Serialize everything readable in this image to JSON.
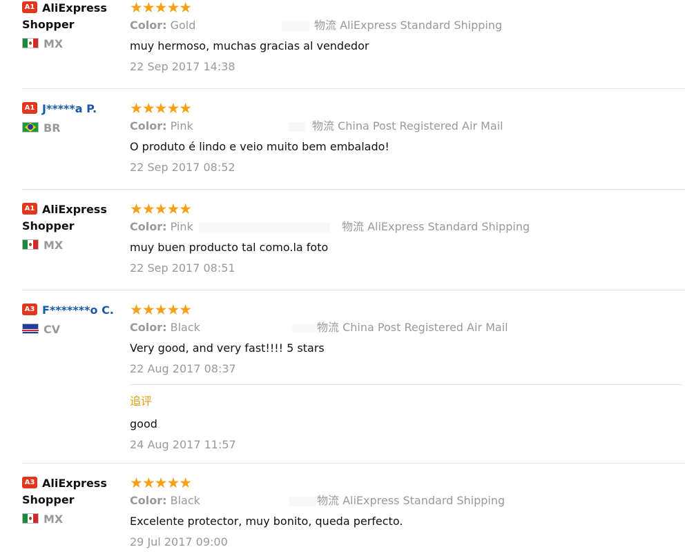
{
  "labels": {
    "color": "Color:"
  },
  "reviews": [
    {
      "badge": "A1",
      "name_line1": "AliExpress",
      "name_line2": "Shopper",
      "country": "MX",
      "stars": "★★★★★",
      "color_value": "Gold",
      "shipping": "物流 AliExpress Standard Shipping",
      "comment": "muy hermoso, muchas gracias al vendedor",
      "date": "22 Sep 2017 14:38"
    },
    {
      "badge": "A1",
      "name_line1": "J*****a P.",
      "name_line2": "",
      "country": "BR",
      "stars": "★★★★★",
      "color_value": "Pink",
      "shipping": "物流 China Post Registered Air Mail",
      "comment": "O produto é lindo e veio muito bem embalado!",
      "date": "22 Sep 2017 08:52"
    },
    {
      "badge": "A1",
      "name_line1": "AliExpress",
      "name_line2": "Shopper",
      "country": "MX",
      "stars": "★★★★★",
      "color_value": "Pink",
      "shipping": "物流 AliExpress Standard Shipping",
      "comment": "muy buen producto tal como.la foto",
      "date": "22 Sep 2017 08:51"
    },
    {
      "badge": "A3",
      "name_line1": "F*******o C.",
      "name_line2": "",
      "country": "CV",
      "stars": "★★★★★",
      "color_value": "Black",
      "shipping": "物流 China Post Registered Air Mail",
      "comment": "Very good, and very fast!!!! 5 stars",
      "date": "22 Aug 2017 08:37",
      "followup_label": "追评",
      "followup_comment": "good",
      "followup_date": "24 Aug 2017 11:57"
    },
    {
      "badge": "A3",
      "name_line1": "AliExpress",
      "name_line2": "Shopper",
      "country": "MX",
      "stars": "★★★★★",
      "color_value": "Black",
      "shipping": "物流 AliExpress Standard Shipping",
      "comment": "Excelente protector, muy bonito, queda perfecto.",
      "date": "29 Jul 2017 09:00"
    }
  ],
  "colors": {
    "badge": "#e2361d",
    "star": "#f6a016",
    "link_name": "#1a59a9",
    "muted": "#999999",
    "followup": "#e29b0c"
  },
  "icons": {
    "mx_flag": "mexico-flag-icon",
    "br_flag": "brazil-flag-icon",
    "cv_flag": "cape-verde-flag-icon",
    "star": "star-icon"
  }
}
